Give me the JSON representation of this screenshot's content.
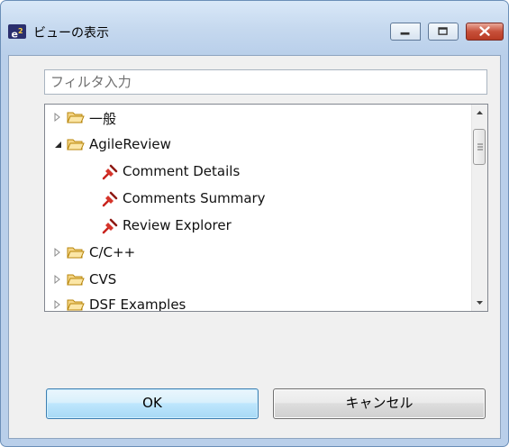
{
  "window": {
    "title": "ビューの表示",
    "app_icon": "e2",
    "controls": [
      "minimize-icon",
      "maximize-icon",
      "close-icon"
    ]
  },
  "filter": {
    "placeholder": "フィルタ入力",
    "value": ""
  },
  "tree": {
    "items": [
      {
        "label": "一般",
        "type": "folder",
        "expanded": false
      },
      {
        "label": "AgileReview",
        "type": "folder",
        "expanded": true
      },
      {
        "label": "Comment Details",
        "type": "view"
      },
      {
        "label": "Comments Summary",
        "type": "view"
      },
      {
        "label": "Review Explorer",
        "type": "view"
      },
      {
        "label": "C/C++",
        "type": "folder",
        "expanded": false
      },
      {
        "label": "CVS",
        "type": "folder",
        "expanded": false
      },
      {
        "label": "DSF Examples",
        "type": "folder",
        "expanded": false
      }
    ]
  },
  "buttons": {
    "ok": "OK",
    "cancel": "キャンセル"
  },
  "colors": {
    "folder": "#e3b94a",
    "view_icon": "#c8231d",
    "ok_border": "#3c7fb1"
  }
}
